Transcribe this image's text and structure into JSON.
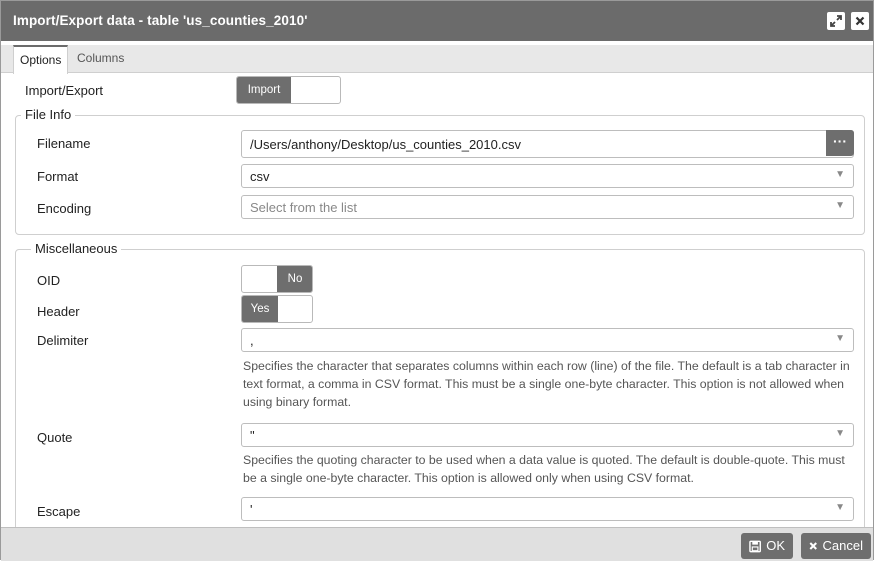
{
  "dialog": {
    "title": "Import/Export data - table 'us_counties_2010'"
  },
  "tabs": [
    {
      "label": "Options",
      "active": true
    },
    {
      "label": "Columns",
      "active": false
    }
  ],
  "import_export": {
    "label": "Import/Export",
    "value": "Import"
  },
  "file_info": {
    "legend": "File Info",
    "filename_label": "Filename",
    "filename_value": "/Users/anthony/Desktop/us_counties_2010.csv",
    "browse_label": "···",
    "format_label": "Format",
    "format_value": "csv",
    "encoding_label": "Encoding",
    "encoding_placeholder": "Select from the list"
  },
  "misc": {
    "legend": "Miscellaneous",
    "oid_label": "OID",
    "oid_value": "No",
    "header_label": "Header",
    "header_value": "Yes",
    "delimiter_label": "Delimiter",
    "delimiter_value": ",",
    "delimiter_help": "Specifies the character that separates columns within each row (line) of the file. The default is a tab character in text format, a comma in CSV format. This must be a single one-byte character. This option is not allowed when using binary format.",
    "quote_label": "Quote",
    "quote_value": "\"",
    "quote_help": "Specifies the quoting character to be used when a data value is quoted. The default is double-quote. This must be a single one-byte character. This option is allowed only when using CSV format.",
    "escape_label": "Escape",
    "escape_value": "'"
  },
  "footer": {
    "ok_label": "OK",
    "cancel_label": "Cancel"
  },
  "colors": {
    "titlebar": "#6b6b6b",
    "accent_button": "#6e6e6e",
    "footer": "#e0e0e0"
  }
}
